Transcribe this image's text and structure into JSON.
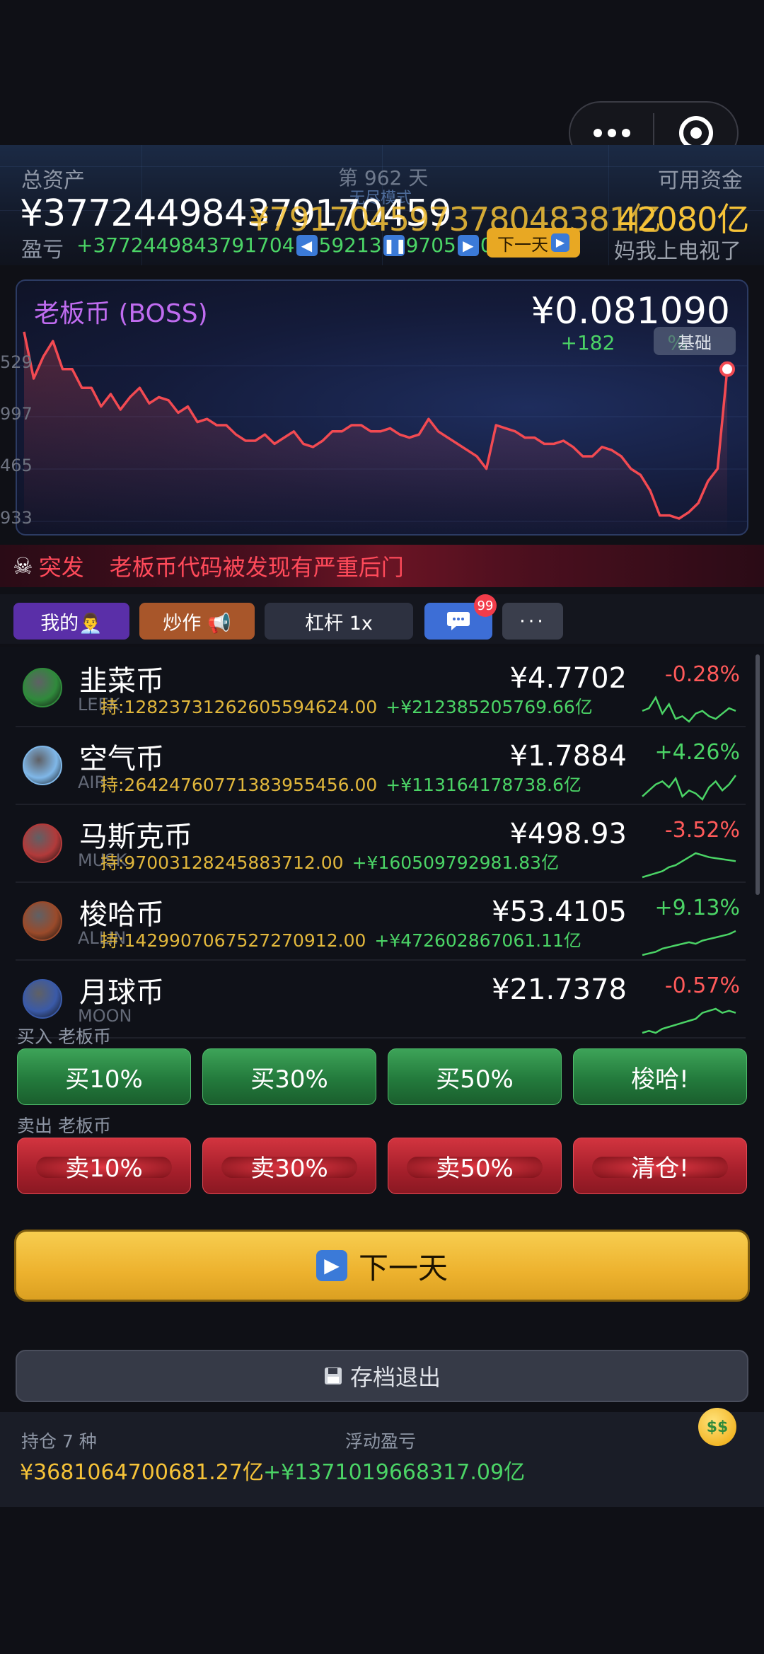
{
  "header": {
    "total_assets_label": "总资产",
    "day_label": "第 962 天",
    "mode_label": "无尽模式",
    "available_label": "可用资金",
    "total_assets_value": "¥377244984379170459",
    "available_overlap_value": "¥791704597378048381亿",
    "available_value": "42080亿",
    "pnl_label": "盈亏",
    "pnl_value": "+3772449843791704",
    "pnl_tail_1": "59213",
    "pnl_tail_2": "9705",
    "pnl_tail_3": "0",
    "next_day_small": "下一天",
    "slogan": "妈我上电视了",
    "icons": [
      "rewind-icon",
      "pause-icon",
      "play-icon"
    ]
  },
  "chart": {
    "coin_name": "老板币 (BOSS)",
    "price": "¥0.081090",
    "change": "+182",
    "change_tail": "%",
    "badge": "基础",
    "y_ticks": [
      "529",
      "997",
      "465",
      "933"
    ]
  },
  "chart_data": {
    "type": "line",
    "title": "老板币 (BOSS)",
    "y_tick_labels": [
      "529",
      "997",
      "465",
      "933"
    ],
    "series": [
      {
        "values": [
          70,
          55,
          62,
          67,
          58,
          58,
          52,
          52,
          46,
          50,
          45,
          49,
          52,
          47,
          49,
          48,
          44,
          46,
          41,
          42,
          40,
          40,
          37,
          35,
          35,
          37,
          34,
          36,
          38,
          34,
          33,
          35,
          38,
          38,
          40,
          40,
          38,
          38,
          39,
          37,
          36,
          37,
          42,
          38,
          36,
          34,
          32,
          30,
          26,
          40,
          39,
          38,
          36,
          36,
          34,
          34,
          35,
          33,
          30,
          30,
          33,
          32,
          30,
          26,
          24,
          19,
          11,
          11,
          10,
          12,
          15,
          22,
          26,
          58
        ]
      }
    ],
    "line_color": "#f24a52"
  },
  "news": {
    "icon": "skull-icon",
    "tag": "突发",
    "message": "老板币代码被发现有严重后门"
  },
  "tabs": {
    "me": "我的👨‍💼",
    "hype": "炒作 📢",
    "leverage": "杠杆 1x",
    "chat_badge": "99",
    "more": "···"
  },
  "coins": [
    {
      "name": "韭菜币",
      "symbol": "LEEK",
      "holding": "持:128237312626055946​24.00",
      "gain": "+¥212385205769.66亿",
      "price": "¥4.7702",
      "change": "-0.28%",
      "dir": "down",
      "spark": [
        20,
        22,
        30,
        18,
        25,
        14,
        16,
        12,
        18,
        20,
        16,
        14,
        18,
        22,
        20
      ],
      "icon_color": "#2f8a3b"
    },
    {
      "name": "空气币",
      "symbol": "AIR",
      "holding": "持:2642476077138395545​6.00",
      "gain": "+¥113164178738.6亿",
      "price": "¥1.7884",
      "change": "+4.26%",
      "dir": "up",
      "spark": [
        18,
        22,
        26,
        28,
        24,
        30,
        18,
        22,
        20,
        16,
        24,
        28,
        22,
        26,
        32
      ],
      "icon_color": "#7fb7e8"
    },
    {
      "name": "马斯克币",
      "symbol": "MUSK",
      "holding": "持:97003128245883712.00",
      "gain": "+¥160509792981.83亿",
      "price": "¥498.93",
      "change": "-3.52%",
      "dir": "down",
      "spark": [
        8,
        10,
        12,
        14,
        18,
        20,
        24,
        28,
        32,
        30,
        28,
        27,
        26,
        25,
        24
      ],
      "icon_color": "#b23a3a"
    },
    {
      "name": "梭哈币",
      "symbol": "ALLIN",
      "holding": "持:142990706752​7270912.00",
      "gain": "+¥472602867061.11亿",
      "price": "¥53.4105",
      "change": "+9.13%",
      "dir": "up",
      "spark": [
        6,
        8,
        10,
        14,
        16,
        18,
        20,
        22,
        20,
        24,
        26,
        28,
        30,
        32,
        36
      ],
      "icon_color": "#9a4a2a"
    },
    {
      "name": "月球币",
      "symbol": "MOON",
      "holding": "",
      "gain": "",
      "price": "¥21.7378",
      "change": "-0.57%",
      "dir": "down",
      "spark": [
        6,
        8,
        6,
        10,
        12,
        14,
        16,
        18,
        20,
        26,
        28,
        30,
        26,
        28,
        26
      ],
      "icon_color": "#3a5aa8"
    }
  ],
  "trade": {
    "buy_label": "买入 老板币",
    "sell_label": "卖出 老板币",
    "buy_buttons": [
      "买10%",
      "买30%",
      "买50%",
      "梭哈!"
    ],
    "sell_buttons": [
      "卖10%",
      "卖30%",
      "卖50%",
      "清仓!"
    ]
  },
  "next_day_button": "下一天",
  "save_button": "存档退出",
  "footer": {
    "holdings_label": "持仓 7 种",
    "holdings_value": "¥3681064700681.27亿",
    "float_label": "浮动盈亏",
    "float_value": "+¥1371019668317.09亿",
    "face_icon": "money-face-icon"
  },
  "colors": {
    "up": "#4bd466",
    "down": "#ff5a5a",
    "gold": "#f6c338",
    "accent_purple": "#c06cf0"
  }
}
